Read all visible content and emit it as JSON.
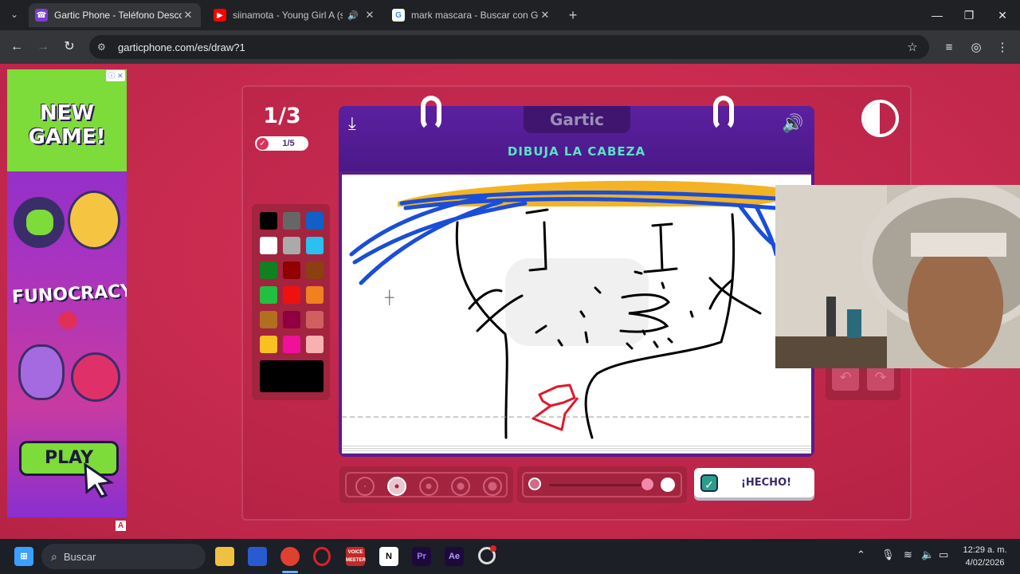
{
  "browser": {
    "tabs": [
      {
        "title": "Gartic Phone - Teléfono Descon",
        "favicon": "phone-icon",
        "active": true
      },
      {
        "title": "siinamota - Young Girl A (sl",
        "favicon": "youtube-icon",
        "active": false,
        "audio": "speaker-icon"
      },
      {
        "title": "mark mascara - Buscar con Goo",
        "favicon": "google-icon",
        "active": false
      }
    ],
    "new_tab_label": "+",
    "url": "garticphone.com/es/draw?1",
    "window_controls": [
      "minimize-icon",
      "maximize-icon",
      "close-icon"
    ]
  },
  "ad": {
    "info_badge": "ⓘ ✕",
    "headline": "NEW GAME!",
    "brand": "FUNOCRACY",
    "play_label": "PLAY",
    "corner_badge": "A"
  },
  "game": {
    "round": "1/3",
    "progress": "1/5",
    "logo": "Gartic",
    "prompt": "DIBUJA LA CABEZA",
    "palette": [
      "#000000",
      "#666666",
      "#1060c8",
      "#ffffff",
      "#aaaaaa",
      "#2ac0f0",
      "#108020",
      "#900000",
      "#8a4010",
      "#20c040",
      "#f01010",
      "#f08020",
      "#b07020",
      "#900040",
      "#d06060",
      "#f8c020",
      "#f0109a",
      "#f8b0b0"
    ],
    "current_color": "#000000",
    "brush_sizes": [
      "xs",
      "s",
      "m",
      "l",
      "xl"
    ],
    "selected_brush": 1,
    "opacity_level": 1.0,
    "done_label": "¡HECHO!",
    "accent": "#d8335c",
    "board_color": "#5a1c8c"
  },
  "taskbar": {
    "search_placeholder": "Buscar",
    "apps": [
      "windows-icon",
      "file-explorer-icon",
      "store-icon",
      "chrome-icon",
      "opera-icon",
      "voicemeeter-icon",
      "notion-icon",
      "premiere-icon",
      "after-effects-icon",
      "obs-icon"
    ],
    "voicemeeter_label": "VOICE MEETER",
    "premiere_label": "Pr",
    "after_effects_label": "Ae",
    "notion_label": "N",
    "time": "12:29 a. m.",
    "date": "4/02/2026"
  }
}
